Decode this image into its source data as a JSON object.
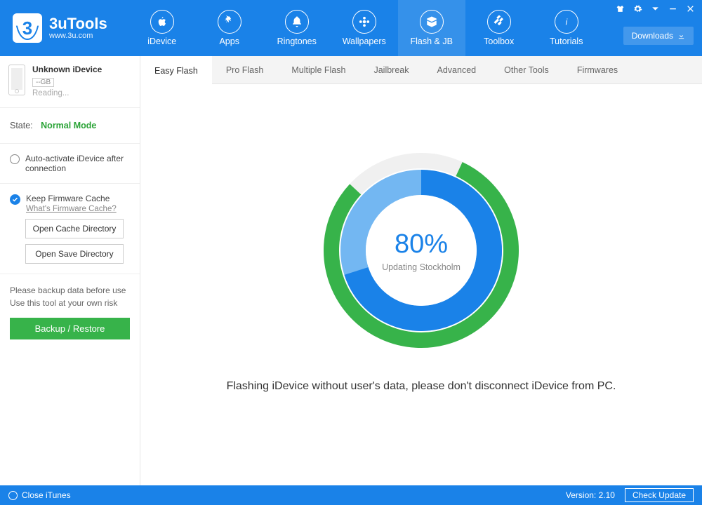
{
  "app": {
    "title": "3uTools",
    "subtitle": "www.3u.com"
  },
  "nav": {
    "items": [
      {
        "label": "iDevice"
      },
      {
        "label": "Apps"
      },
      {
        "label": "Ringtones"
      },
      {
        "label": "Wallpapers"
      },
      {
        "label": "Flash & JB"
      },
      {
        "label": "Toolbox"
      },
      {
        "label": "Tutorials"
      }
    ],
    "active_index": 4
  },
  "downloads_label": "Downloads",
  "sidebar": {
    "device_name": "Unknown iDevice",
    "device_capacity": "--GB",
    "device_reading": "Reading...",
    "state_label": "State:",
    "state_value": "Normal Mode",
    "auto_activate_label": "Auto-activate iDevice after connection",
    "keep_cache_label": "Keep Firmware Cache",
    "cache_help": "What's Firmware Cache?",
    "open_cache_btn": "Open Cache Directory",
    "open_save_btn": "Open Save Directory",
    "warn_line1": "Please backup data before use",
    "warn_line2": "Use this tool at your own risk",
    "backup_btn": "Backup / Restore"
  },
  "tabs": {
    "items": [
      "Easy Flash",
      "Pro Flash",
      "Multiple Flash",
      "Jailbreak",
      "Advanced",
      "Other Tools",
      "Firmwares"
    ],
    "active_index": 0
  },
  "progress": {
    "percent_label": "80%",
    "outer_percent": 80,
    "inner_percent": 70,
    "status_text": "Updating Stockholm"
  },
  "flash_message": "Flashing iDevice without user's data, please don't disconnect iDevice from PC.",
  "footer": {
    "close_itunes": "Close iTunes",
    "version": "Version: 2.10",
    "check_update": "Check Update"
  },
  "colors": {
    "primary": "#1a82e8",
    "green": "#37b34a"
  }
}
